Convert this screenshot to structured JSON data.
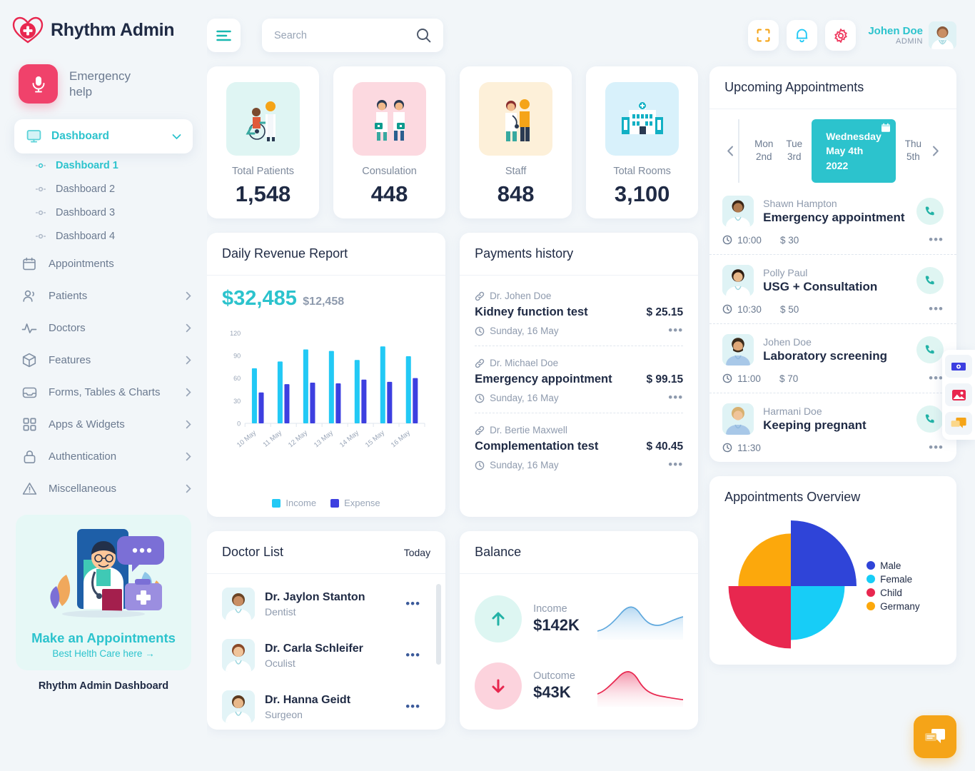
{
  "brand": {
    "title": "Rhythm Admin",
    "logo_icon": "heart-cross-logo"
  },
  "sidebar": {
    "emergency": {
      "label": "Emergency help",
      "icon": "microphone-icon"
    },
    "active_group": {
      "label": "Dashboard",
      "icon": "monitor-icon",
      "chevron": "chevron-down-icon"
    },
    "sub_items": [
      {
        "label": "Dashboard 1",
        "active": true
      },
      {
        "label": "Dashboard 2",
        "active": false
      },
      {
        "label": "Dashboard 3",
        "active": false
      },
      {
        "label": "Dashboard 4",
        "active": false
      }
    ],
    "items": [
      {
        "label": "Appointments",
        "icon": "calendar-icon",
        "has_chevron": false
      },
      {
        "label": "Patients",
        "icon": "users-icon",
        "has_chevron": true
      },
      {
        "label": "Doctors",
        "icon": "pulse-icon",
        "has_chevron": true
      },
      {
        "label": "Features",
        "icon": "box-icon",
        "has_chevron": true
      },
      {
        "label": "Forms, Tables & Charts",
        "icon": "inbox-icon",
        "has_chevron": true
      },
      {
        "label": "Apps & Widgets",
        "icon": "grid-icon",
        "has_chevron": true
      },
      {
        "label": "Authentication",
        "icon": "lock-icon",
        "has_chevron": true
      },
      {
        "label": "Miscellaneous",
        "icon": "warning-icon",
        "has_chevron": true
      }
    ],
    "promo": {
      "title": "Make an Appointments",
      "subtitle": "Best Helth Care here →",
      "art": "doctor-illustration"
    },
    "footer": "Rhythm Admin Dashboard"
  },
  "header": {
    "menu_icon": "hamburger-icon",
    "search": {
      "placeholder": "Search",
      "value": "",
      "icon": "search-icon"
    },
    "actions": [
      {
        "name": "fullscreen-icon",
        "color": "#f5a418"
      },
      {
        "name": "bell-icon",
        "color": "#22c9f5"
      },
      {
        "name": "gear-icon",
        "color": "#ef3d62"
      }
    ],
    "user": {
      "name": "Johen Doe",
      "role": "ADMIN",
      "avatar": "user-avatar"
    }
  },
  "stats": [
    {
      "label": "Total Patients",
      "value": "1,548",
      "tile_color": "#dff5f3",
      "art": "wheelchair-patient-illustration"
    },
    {
      "label": "Consulation",
      "value": "448",
      "tile_color": "#fcd9e0",
      "art": "two-doctors-illustration"
    },
    {
      "label": "Staff",
      "value": "848",
      "tile_color": "#fdf0d9",
      "art": "doctor-patient-illustration"
    },
    {
      "label": "Total Rooms",
      "value": "3,100",
      "tile_color": "#d8f1fb",
      "art": "hospital-building-illustration"
    }
  ],
  "revenue": {
    "title": "Daily Revenue Report",
    "amount": "$32,485",
    "secondary": "$12,458"
  },
  "chart_data": [
    {
      "type": "bar",
      "title": "Daily Revenue Report",
      "categories": [
        "10 May",
        "11 May",
        "12 May",
        "13 May",
        "14 May",
        "15 May",
        "16 May"
      ],
      "series": [
        {
          "name": "Income",
          "color": "#22c9f5",
          "values": [
            73,
            82,
            98,
            96,
            84,
            102,
            89
          ]
        },
        {
          "name": "Expense",
          "color": "#3d3fe0",
          "values": [
            41,
            52,
            54,
            53,
            58,
            55,
            60
          ]
        }
      ],
      "yticks": [
        0,
        30,
        60,
        90,
        120
      ],
      "ylim": [
        0,
        125
      ],
      "xlabel": "",
      "ylabel": "",
      "grid": false,
      "legend_position": "bottom"
    },
    {
      "type": "pie",
      "title": "Appointments Overview",
      "categories": [
        "Male",
        "Female",
        "Child",
        "Germany"
      ],
      "values": [
        25,
        25,
        25,
        25
      ],
      "radii": [
        100,
        82,
        95,
        80
      ],
      "colors": [
        "#2f44d8",
        "#17cdf7",
        "#e8274f",
        "#fca80c"
      ],
      "legend_position": "right"
    },
    {
      "type": "area",
      "title": "Income",
      "color": "#6ba9e0",
      "values": [
        12,
        20,
        40,
        62,
        48,
        33,
        30,
        45,
        50
      ],
      "x": [
        0,
        1,
        2,
        3,
        4,
        5,
        6,
        7,
        8
      ]
    },
    {
      "type": "area",
      "title": "Outcome",
      "color": "#e8274f",
      "values": [
        18,
        30,
        55,
        68,
        55,
        28,
        20,
        16,
        12
      ],
      "x": [
        0,
        1,
        2,
        3,
        4,
        5,
        6,
        7,
        8
      ]
    }
  ],
  "payments": {
    "title": "Payments history",
    "rows": [
      {
        "doctor": "Dr. Johen Doe",
        "service": "Kidney function test",
        "amount": "$ 25.15",
        "date": "Sunday, 16 May"
      },
      {
        "doctor": "Dr. Michael Doe",
        "service": "Emergency appointment",
        "amount": "$ 99.15",
        "date": "Sunday, 16 May"
      },
      {
        "doctor": "Dr. Bertie Maxwell",
        "service": "Complementation test",
        "amount": "$ 40.45",
        "date": "Sunday, 16 May"
      }
    ]
  },
  "appointments": {
    "title": "Upcoming Appointments",
    "days": [
      {
        "name": "Mon",
        "num": "2nd"
      },
      {
        "name": "Tue",
        "num": "3rd"
      }
    ],
    "selected_day": {
      "weekday": "Wednesday",
      "date": "May 4th 2022",
      "icon": "calendar-icon"
    },
    "days_after": [
      {
        "name": "Thu",
        "num": "5th"
      }
    ],
    "prev_icon": "chevron-left-icon",
    "next_icon": "chevron-right-icon",
    "rows": [
      {
        "who": "Shawn Hampton",
        "what": "Emergency appointment",
        "time": "10:00",
        "price": "$ 30"
      },
      {
        "who": "Polly Paul",
        "what": "USG + Consultation",
        "time": "10:30",
        "price": "$ 50"
      },
      {
        "who": "Johen Doe",
        "what": "Laboratory screening",
        "time": "11:00",
        "price": "$ 70"
      },
      {
        "who": "Harmani Doe",
        "what": "Keeping pregnant",
        "time": "11:30",
        "price": ""
      }
    ]
  },
  "doctors": {
    "title": "Doctor List",
    "filter": "Today",
    "rows": [
      {
        "name": "Dr. Jaylon Stanton",
        "specialty": "Dentist"
      },
      {
        "name": "Dr. Carla Schleifer",
        "specialty": "Oculist"
      },
      {
        "name": "Dr. Hanna Geidt",
        "specialty": "Surgeon"
      }
    ]
  },
  "balance": {
    "title": "Balance",
    "rows": [
      {
        "label": "Income",
        "amount": "$142K",
        "icon": "arrow-up-icon",
        "circle": "#ddf6f2",
        "arrow_color": "#22b2a6"
      },
      {
        "label": "Outcome",
        "amount": "$43K",
        "icon": "arrow-down-icon",
        "circle": "#fcd3dd",
        "arrow_color": "#e8274f"
      }
    ]
  },
  "overview": {
    "title": "Appointments Overview"
  },
  "float_buttons": [
    {
      "name": "cash-icon",
      "color": "#3d3fe0"
    },
    {
      "name": "image-icon",
      "color": "#e8274f"
    },
    {
      "name": "chat-icon",
      "color": "#f5a418"
    }
  ],
  "chat_fab": {
    "name": "chat-icon",
    "color": "#f5a418"
  }
}
